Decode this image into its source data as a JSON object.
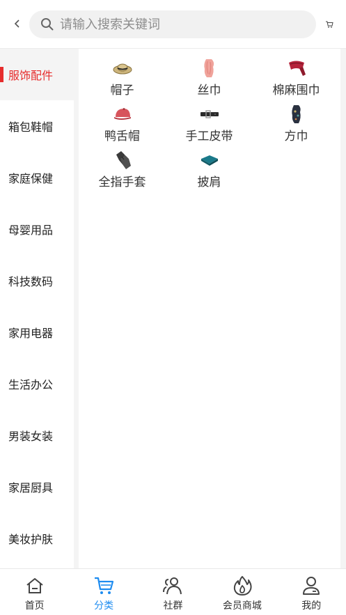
{
  "header": {
    "search_placeholder": "请输入搜索关键词",
    "icons": {
      "back": "chevron-left-icon",
      "search": "search-icon",
      "cart": "cart-icon"
    }
  },
  "sidebar": {
    "items": [
      {
        "label": "服饰配件",
        "active": true
      },
      {
        "label": "箱包鞋帽",
        "active": false
      },
      {
        "label": "家庭保健",
        "active": false
      },
      {
        "label": "母婴用品",
        "active": false
      },
      {
        "label": "科技数码",
        "active": false
      },
      {
        "label": "家用电器",
        "active": false
      },
      {
        "label": "生活办公",
        "active": false
      },
      {
        "label": "男装女装",
        "active": false
      },
      {
        "label": "家居厨具",
        "active": false
      },
      {
        "label": "美妆护肤",
        "active": false
      }
    ]
  },
  "subcategories": [
    {
      "label": "帽子",
      "icon": "straw-hat-icon"
    },
    {
      "label": "丝巾",
      "icon": "silk-scarf-icon"
    },
    {
      "label": "棉麻围巾",
      "icon": "linen-scarf-icon"
    },
    {
      "label": "鸭舌帽",
      "icon": "baseball-cap-icon"
    },
    {
      "label": "手工皮带",
      "icon": "leather-belt-icon"
    },
    {
      "label": "方巾",
      "icon": "square-scarf-icon"
    },
    {
      "label": "全指手套",
      "icon": "gloves-icon"
    },
    {
      "label": "披肩",
      "icon": "shawl-icon"
    }
  ],
  "tabbar": {
    "tabs": [
      {
        "label": "首页",
        "icon": "home-icon",
        "active": false
      },
      {
        "label": "分类",
        "icon": "category-cart-icon",
        "active": true
      },
      {
        "label": "社群",
        "icon": "community-icon",
        "active": false
      },
      {
        "label": "会员商城",
        "icon": "flame-icon",
        "active": false
      },
      {
        "label": "我的",
        "icon": "profile-icon",
        "active": false
      }
    ]
  },
  "colors": {
    "accent_red": "#e62c2c",
    "accent_blue": "#1e8cf0",
    "background": "#f4f4f4"
  }
}
